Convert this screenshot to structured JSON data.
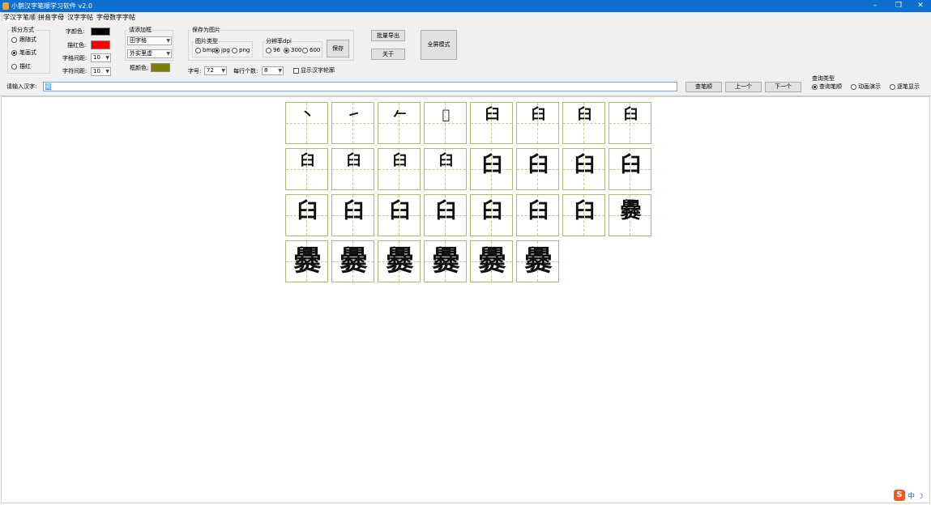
{
  "app": {
    "title": "小鹅汉字笔顺学习软件 v2.0"
  },
  "window_buttons": {
    "minimize": "–",
    "maximize": "❐",
    "close": "✕"
  },
  "menu": [
    "学汉字笔顺",
    "拼音字母",
    "汉字字帖",
    "字母数字字帖"
  ],
  "split": {
    "title": "拆分方式",
    "options": [
      "跟随式",
      "笔画式",
      "描红"
    ],
    "selected": 1
  },
  "colors": {
    "font_color_label": "字颜色:",
    "font_color": "#000000",
    "trace_color_label": "描红色:",
    "trace_color": "#ff0000",
    "outline_color_label": "框颜色:",
    "outline_color": "#808000"
  },
  "spacing": {
    "char_spacing_label": "字格间距:",
    "char_spacing_value": "10",
    "font_spacing_label": "字符间距:",
    "font_spacing_value": "10"
  },
  "border": {
    "title": "请添加框",
    "grid_value": "田字格",
    "outer_value": "外实里虚"
  },
  "save_image": {
    "title": "保存为图片",
    "type_label": "图片类型",
    "types": [
      "bmp",
      "jpg",
      "png"
    ],
    "type_selected": 1,
    "dpi_label": "分辨率dpi",
    "dpis": [
      "96",
      "300",
      "600"
    ],
    "dpi_selected": 1,
    "save_button": "保存"
  },
  "font_size": {
    "label": "字号:",
    "value": "72"
  },
  "per_row": {
    "label": "每行个数:",
    "value": "8"
  },
  "show_outline": {
    "label": "显示汉字轮廓",
    "checked": false
  },
  "buttons": {
    "batch_export": "批量导出",
    "about": "关于",
    "fullscreen": "全屏模式",
    "query": "查笔顺",
    "prev": "上一个",
    "next": "下一个"
  },
  "input": {
    "label": "请输入汉字:",
    "value": "爨"
  },
  "query_type": {
    "title": "查询类型",
    "options": [
      "查询笔顺",
      "动画演示",
      "逐笔显示"
    ],
    "selected": 0
  },
  "strokes": [
    "丶",
    "㇀",
    "𠂉",
    "𠂋",
    "臼",
    "𦥑",
    "𦥑",
    "𦥑",
    "𦥑",
    "𦥑",
    "𦥑",
    "𦥑",
    "𦥑",
    "𦥑",
    "𦥑",
    "𦥑",
    "𦥑",
    "𦥑",
    "𦥑",
    "𦥑",
    "𦥑",
    "𦥑",
    "𦥑",
    "爨",
    "爨",
    "爨",
    "爨",
    "爨",
    "爨",
    "爨"
  ],
  "tray": {
    "ime_logo": "S",
    "ime_mode": "中",
    "moon": "☽"
  }
}
